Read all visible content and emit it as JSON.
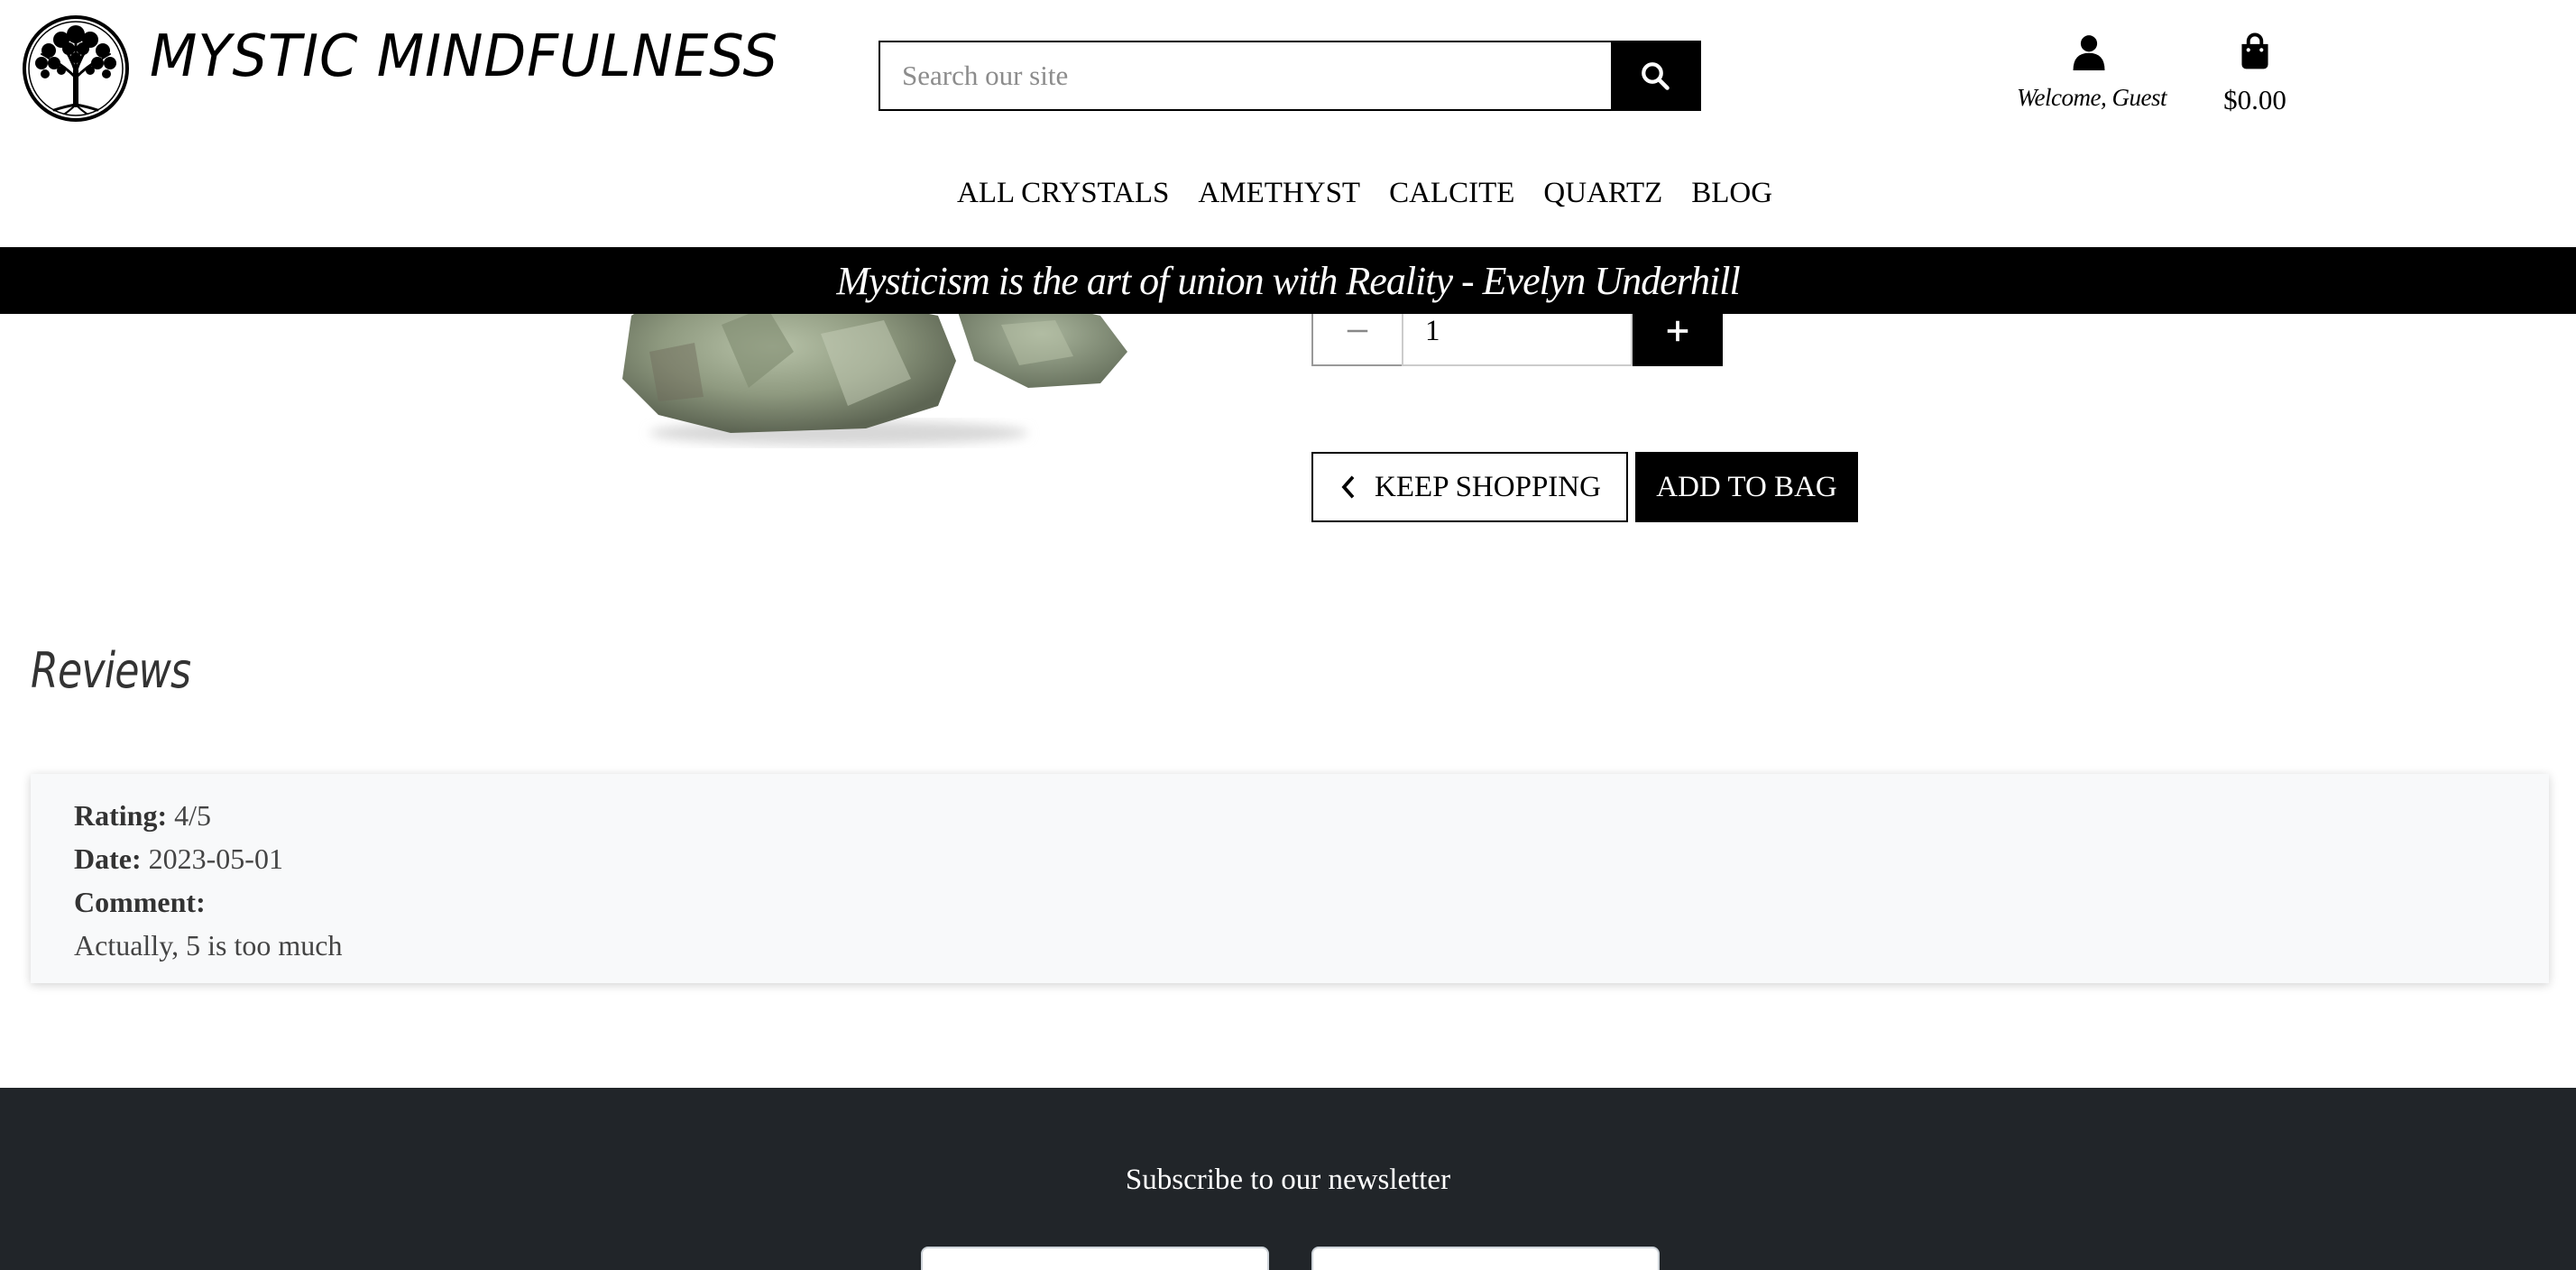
{
  "brand": {
    "name": "MYSTIC MINDFULNESS"
  },
  "search": {
    "placeholder": "Search our site"
  },
  "account": {
    "label": "Welcome, Guest"
  },
  "bag": {
    "total": "$0.00"
  },
  "nav": {
    "items": [
      {
        "label": "ALL CRYSTALS"
      },
      {
        "label": "AMETHYST"
      },
      {
        "label": "CALCITE"
      },
      {
        "label": "QUARTZ"
      },
      {
        "label": "BLOG"
      }
    ]
  },
  "quote": {
    "text": "Mysticism is the art of union with Reality - Evelyn Underhill"
  },
  "product": {
    "quantity": "1",
    "keep_shopping_label": "KEEP SHOPPING",
    "add_to_bag_label": "ADD TO BAG"
  },
  "reviews": {
    "title": "Reviews",
    "items": [
      {
        "rating_label": "Rating:",
        "rating": "4/5",
        "date_label": "Date:",
        "date": "2023-05-01",
        "comment_label": "Comment:",
        "comment": "Actually, 5 is too much"
      }
    ]
  },
  "footer": {
    "newsletter_title": "Subscribe to our newsletter"
  },
  "icons": {
    "search": "search-icon",
    "user": "user-icon",
    "bag": "shopping-bag-icon",
    "minus": "minus-icon",
    "plus": "plus-icon",
    "chevron": "chevron-left-icon",
    "logo": "tree-of-life-icon"
  },
  "colors": {
    "primary": "#000000",
    "footer_bg": "#212529",
    "card_bg": "#f8f9fa"
  }
}
